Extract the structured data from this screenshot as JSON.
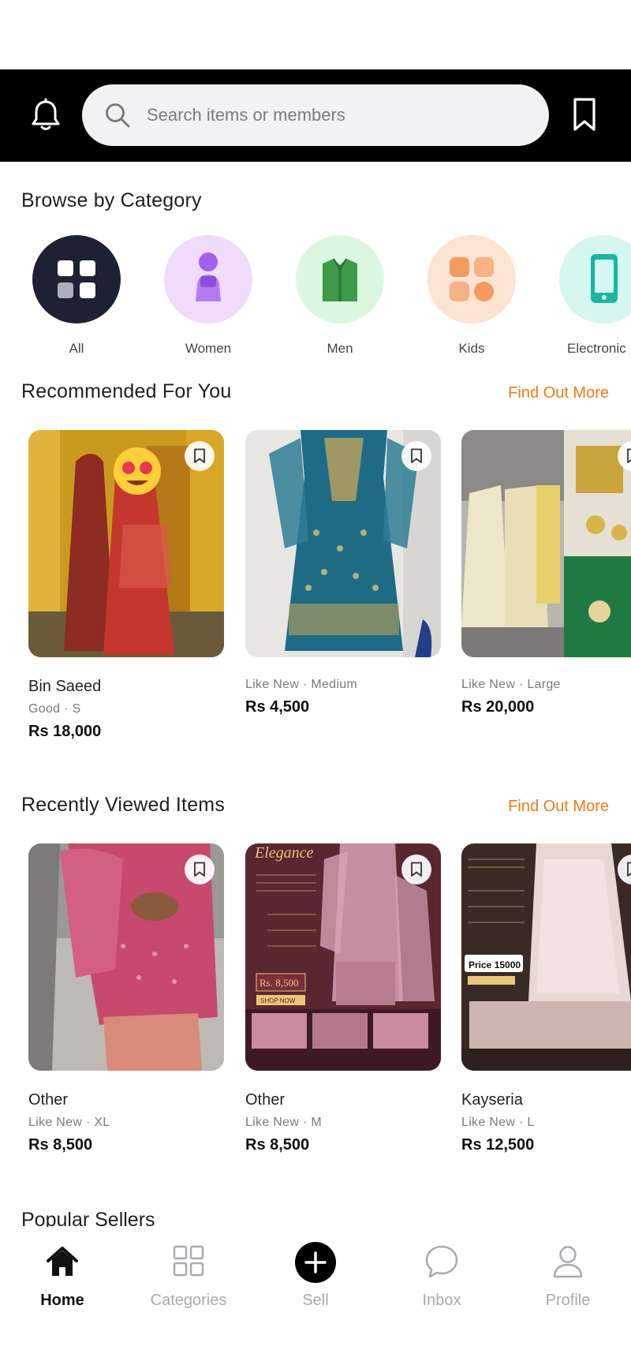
{
  "header": {
    "search_placeholder": "Search items or members"
  },
  "categories": {
    "title": "Browse by Category",
    "items": [
      {
        "label": "All",
        "icon": "grid-icon",
        "bg": "#1c2233"
      },
      {
        "label": "Women",
        "icon": "woman-icon",
        "bg": "#efdcfb"
      },
      {
        "label": "Men",
        "icon": "shirt-icon",
        "bg": "#dcf7df"
      },
      {
        "label": "Kids",
        "icon": "kids-icon",
        "bg": "#fde3d2"
      },
      {
        "label": "Electronic",
        "icon": "phone-icon",
        "bg": "#d6f6f0"
      }
    ]
  },
  "recommended": {
    "title": "Recommended For You",
    "more": "Find Out More",
    "items": [
      {
        "brand": "Bin Saeed",
        "condition": "Good · S",
        "price": "Rs 18,000"
      },
      {
        "brand": "",
        "condition": "Like New · Medium",
        "price": "Rs 4,500"
      },
      {
        "brand": "",
        "condition": "Like New · Large",
        "price": "Rs 20,000"
      }
    ]
  },
  "recent": {
    "title": "Recently Viewed Items",
    "more": "Find Out More",
    "items": [
      {
        "brand": "Other",
        "condition": "Like New · XL",
        "price": "Rs 8,500"
      },
      {
        "brand": "Other",
        "condition": "Like New · M",
        "price": "Rs 8,500"
      },
      {
        "brand": "Kayseria",
        "condition": "Like New · L",
        "price": "Rs 12,500"
      }
    ],
    "photo_texts": {
      "elegance": "Elegance",
      "price_tag": "Rs. 8,500",
      "shop_now": "SHOP NOW",
      "price_15000": "Price 15000"
    }
  },
  "popular": {
    "title": "Popular Sellers"
  },
  "tabs": [
    {
      "label": "Home",
      "icon": "home-icon",
      "active": true
    },
    {
      "label": "Categories",
      "icon": "categories-icon",
      "active": false
    },
    {
      "label": "Sell",
      "icon": "sell-plus-icon",
      "active": false
    },
    {
      "label": "Inbox",
      "icon": "chat-bubble-icon",
      "active": false
    },
    {
      "label": "Profile",
      "icon": "person-icon",
      "active": false
    }
  ],
  "colors": {
    "accent": "#f07b14",
    "header_bg": "#000000"
  }
}
